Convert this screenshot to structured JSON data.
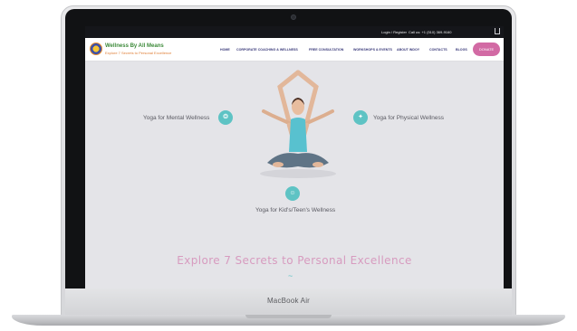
{
  "device": {
    "label": "MacBook Air"
  },
  "site": {
    "topbar": {
      "login": "Login / Register",
      "call": "Call us: +1 (510) 369-9160"
    },
    "logo": {
      "title": "Wellness By All Means",
      "tagline": "Explore 7 Secrets to Personal Excellence"
    },
    "nav": [
      "HOME",
      "CORPORATE COACHING & WELLNESS",
      "FREE CONSULTATION",
      "WORKSHOPS & EVENTS",
      "ABOUT INDOY",
      "CONTACTS",
      "BLOGS"
    ],
    "donate": "DONATE",
    "features": {
      "mental": "Yoga for Mental Wellness",
      "physical": "Yoga for Physical Wellness",
      "kids": "Yoga for Kid's/Teen's Wellness"
    },
    "headline": "Explore 7 Secrets to Personal Excellence",
    "wave": "~"
  },
  "colors": {
    "accent": "#5ec3c4",
    "pink": "#d79bbf",
    "donate": "#d26aa4",
    "nav": "#3a3a7a"
  },
  "icons": [
    "cart-icon",
    "brain-icon",
    "muscle-icon",
    "kids-icon",
    "wave-icon"
  ]
}
